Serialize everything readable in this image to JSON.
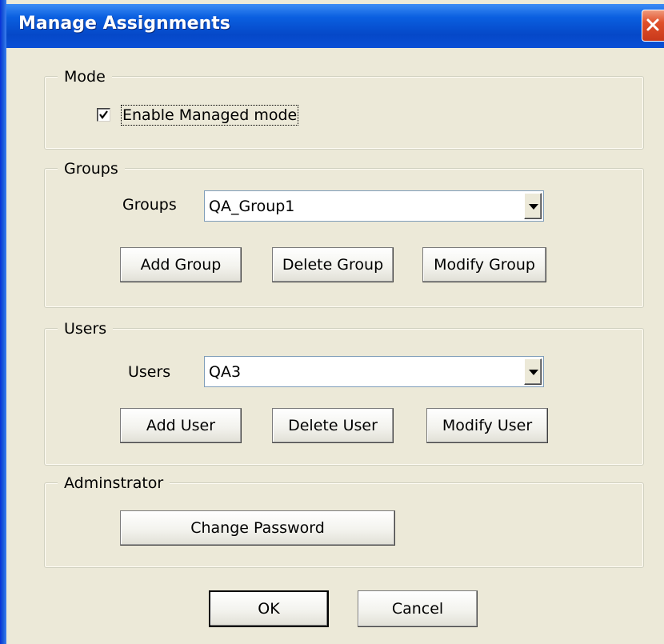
{
  "window": {
    "title": "Manage Assignments",
    "close_icon": "close-icon"
  },
  "mode": {
    "legend": "Mode",
    "checkbox_label": "Enable Managed mode",
    "checked": true
  },
  "groups": {
    "legend": "Groups",
    "field_label": "Groups",
    "selected": "QA_Group1",
    "add_label": "Add Group",
    "delete_label": "Delete Group",
    "modify_label": "Modify Group"
  },
  "users": {
    "legend": "Users",
    "field_label": "Users",
    "selected": "QA3",
    "add_label": "Add User",
    "delete_label": "Delete User",
    "modify_label": "Modify User"
  },
  "admin": {
    "legend": "Adminstrator",
    "change_password_label": "Change Password"
  },
  "footer": {
    "ok_label": "OK",
    "cancel_label": "Cancel"
  }
}
